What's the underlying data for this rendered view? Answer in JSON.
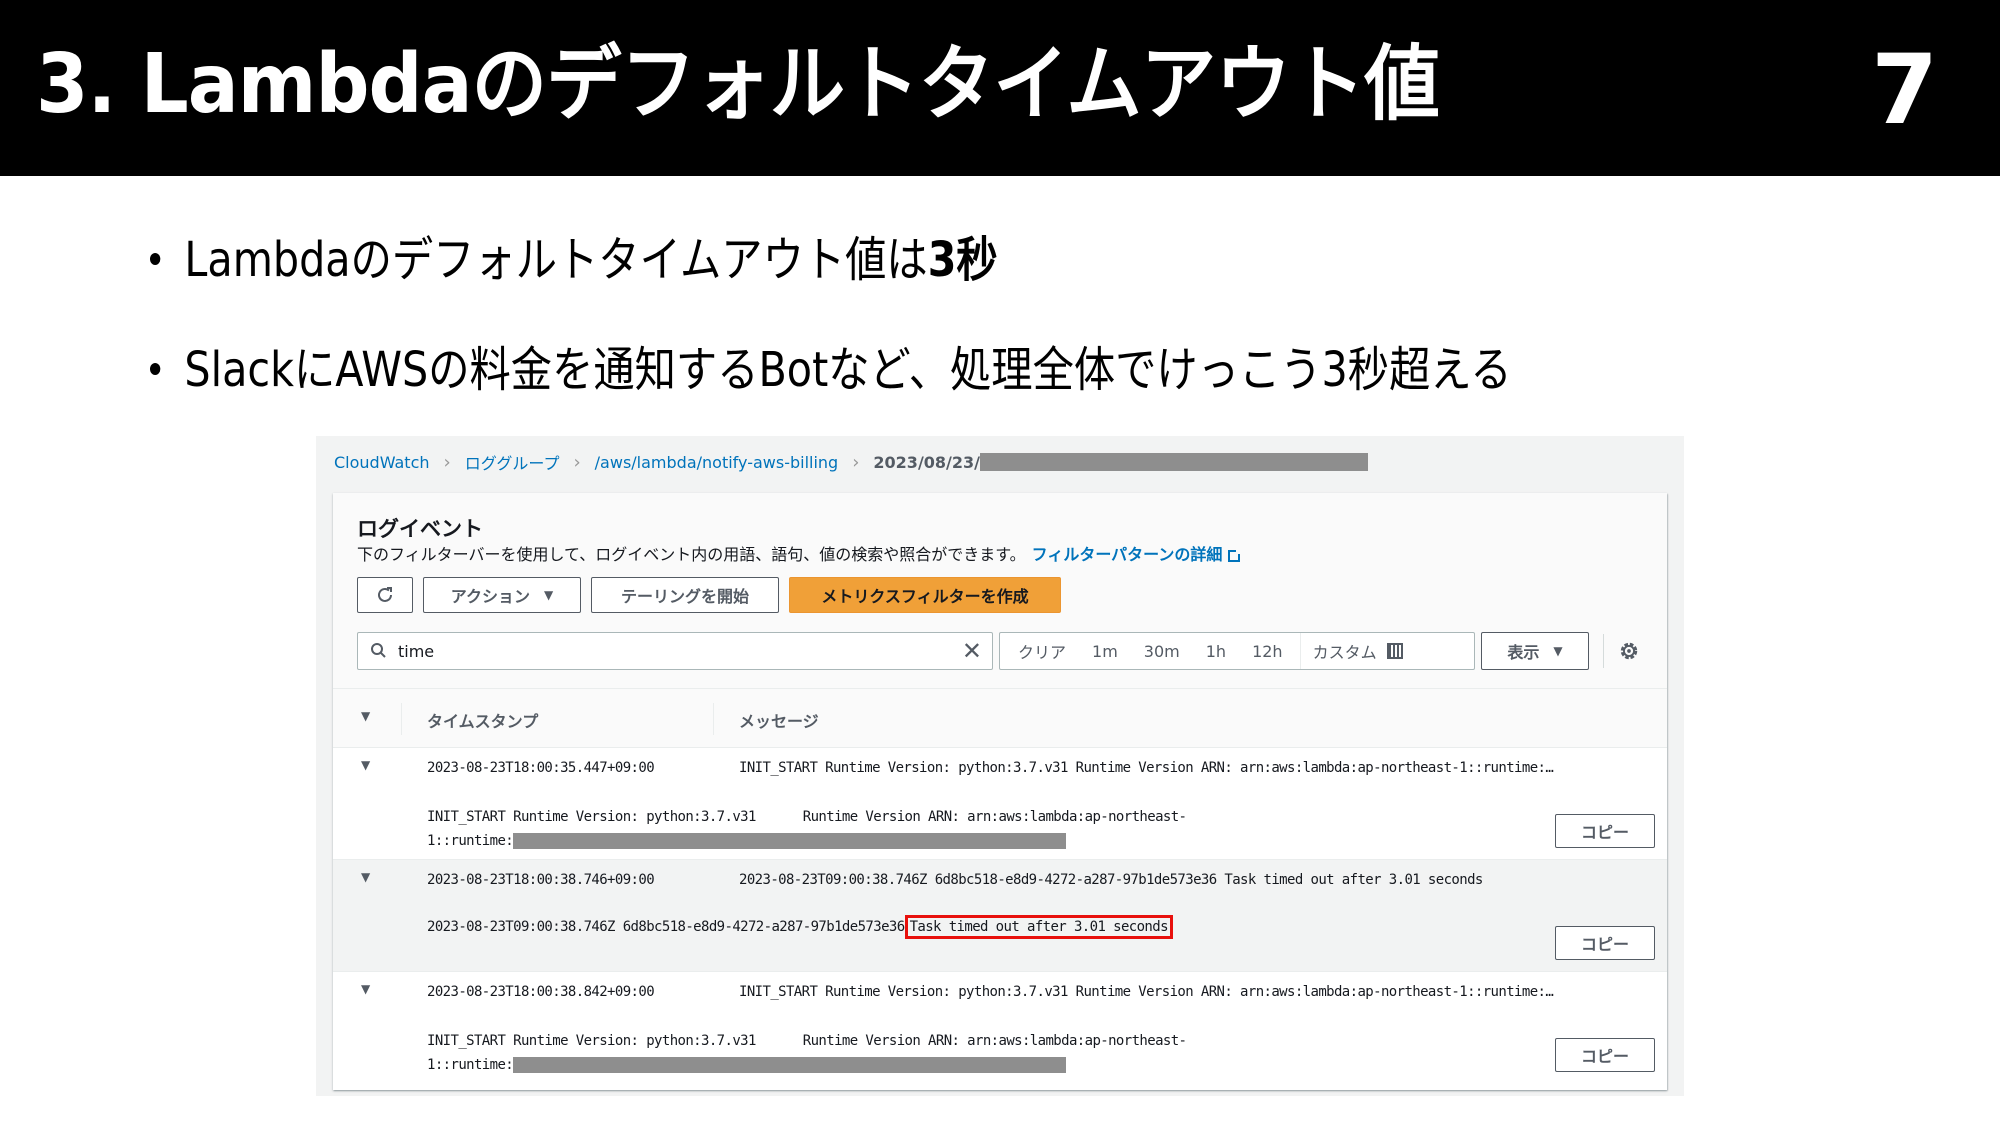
{
  "slide": {
    "title": "3. Lambdaのデフォルトタイムアウト値",
    "page_number": "7",
    "bullets": [
      {
        "text": "Lambdaのデフォルトタイムアウト値は",
        "bold": "3秒"
      },
      {
        "text": "SlackにAWSの料金を通知するBotなど、処理全体でけっこう3秒超える",
        "bold": ""
      }
    ]
  },
  "aws": {
    "breadcrumb": [
      {
        "label": "CloudWatch",
        "link": true
      },
      {
        "label": "ロググループ",
        "link": true
      },
      {
        "label": "/aws/lambda/notify-aws-billing",
        "link": true
      },
      {
        "label": "2023/08/23/",
        "link": false,
        "redacted": true
      }
    ],
    "card": {
      "title": "ログイベント",
      "description": "下のフィルターバーを使用して、ログイベント内の用語、語句、値の検索や照合ができます。",
      "learn_more_link": "フィルターパターンの詳細",
      "buttons": {
        "refresh_icon": "refresh-icon",
        "actions": "アクション",
        "tail": "テーリングを開始",
        "create_metric_filter": "メトリクスフィルターを作成"
      },
      "filter": {
        "value": "time",
        "clear_icon": "close-icon",
        "ranges": [
          "クリア",
          "1m",
          "30m",
          "1h",
          "12h"
        ],
        "custom": "カスタム",
        "display": "表示"
      },
      "accent_color": "#f0a038",
      "link_color": "#0073bb",
      "highlight_color": "#e8100c"
    },
    "table": {
      "headers": {
        "timestamp": "タイムスタンプ",
        "message": "メッセージ"
      },
      "rows": [
        {
          "timestamp": "2023-08-23T18:00:35.447+09:00",
          "message": "INIT_START Runtime Version: python:3.7.v31 Runtime Version ARN: arn:aws:lambda:ap-northeast-1::runtime:…",
          "detail_line1": "INIT_START Runtime Version: python:3.7.v31      Runtime Version ARN: arn:aws:lambda:ap-northeast-",
          "detail_line2": "1::runtime:",
          "copy": "コピー"
        },
        {
          "timestamp": "2023-08-23T18:00:38.746+09:00",
          "message": "2023-08-23T09:00:38.746Z 6d8bc518-e8d9-4272-a287-97b1de573e36 Task timed out after 3.01 seconds",
          "detail_prefix": "2023-08-23T09:00:38.746Z 6d8bc518-e8d9-4272-a287-97b1de573e36",
          "detail_highlight": "Task timed out after 3.01 seconds",
          "copy": "コピー"
        },
        {
          "timestamp": "2023-08-23T18:00:38.842+09:00",
          "message": "INIT_START Runtime Version: python:3.7.v31 Runtime Version ARN: arn:aws:lambda:ap-northeast-1::runtime:…",
          "detail_line1": "INIT_START Runtime Version: python:3.7.v31      Runtime Version ARN: arn:aws:lambda:ap-northeast-",
          "detail_line2": "1::runtime:",
          "copy": "コピー"
        }
      ]
    }
  }
}
